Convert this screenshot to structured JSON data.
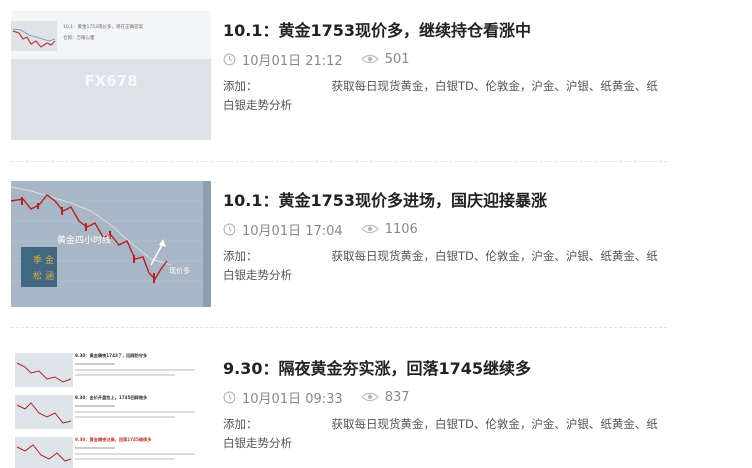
{
  "articles": [
    {
      "title": "10.1：黄金1753现价多，继续持仓看涨中",
      "date": "10月01日 21:12",
      "views": "501",
      "desc_prefix": "添加：",
      "desc_body": "获取每日现货黄金，白银TD、伦敦金，沪金、沪银、纸黄金、纸白银走势分析",
      "thumb": {
        "watermark": "FX678",
        "caption_lines": [
          "10.1：黄金1753现价多，现在正确答案",
          "仓到：万眼心量"
        ]
      }
    },
    {
      "title": "10.1：黄金1753现价多进场，国庆迎接暴涨",
      "date": "10月01日 17:04",
      "views": "1106",
      "desc_prefix": "添加：",
      "desc_body": "获取每日现货黄金，白银TD、伦敦金，沪金、沪银、纸黄金、纸白银走势分析",
      "thumb": {
        "chart_label": "黄金四小时线",
        "seal_text": [
          "季",
          "金",
          "松",
          "涵"
        ],
        "buy_label": "现价多"
      }
    },
    {
      "title": "9.30：隔夜黄金夯实涨，回落1745继续多",
      "date": "10月01日 09:33",
      "views": "837",
      "desc_prefix": "添加：",
      "desc_body": "获取每日现货黄金，白银TD、伦敦金，沪金、沪银、纸黄金、纸白银走势分析",
      "thumb": {
        "row_titles": [
          "9.30：黄金隔夜1743了，回踩防守多",
          "9.30：金价开盘拉上，1745回踩做多",
          "9.30：黄金隔夜过高，回落1745继续多"
        ]
      }
    }
  ],
  "colors": {
    "title": "#222222",
    "meta": "#888888",
    "desc": "#555555",
    "divider": "#e3e3e3"
  },
  "icons": {
    "time": "clock-icon",
    "views": "eye-icon"
  }
}
